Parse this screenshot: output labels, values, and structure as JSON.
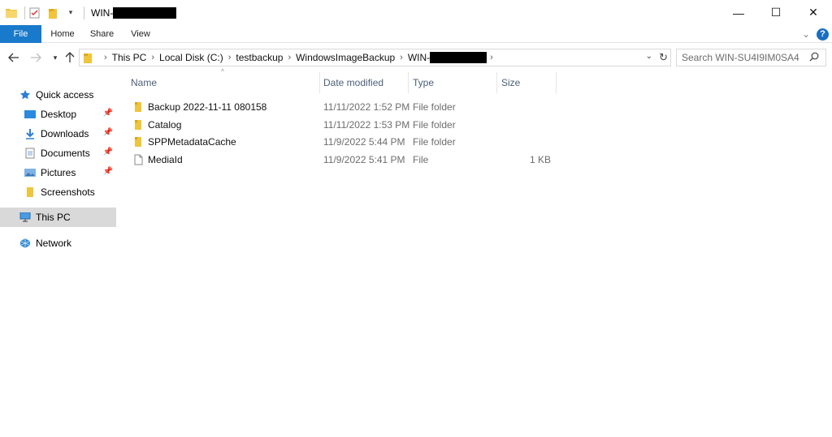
{
  "window": {
    "title_prefix": "WIN-",
    "minimize": "—",
    "maximize": "☐",
    "close": "✕"
  },
  "ribbon": {
    "tabs": [
      "File",
      "Home",
      "Share",
      "View"
    ],
    "expand": "⌄",
    "help": "?"
  },
  "address": {
    "crumbs": [
      "This PC",
      "Local Disk (C:)",
      "testbackup",
      "WindowsImageBackup",
      "WIN-"
    ]
  },
  "search": {
    "placeholder": "Search WIN-SU4I9IM0SA4"
  },
  "nav": {
    "items": [
      {
        "label": "Quick access",
        "icon": "star-icon"
      },
      {
        "label": "Desktop",
        "icon": "desktop-icon",
        "pinned": true
      },
      {
        "label": "Downloads",
        "icon": "download-icon",
        "pinned": true
      },
      {
        "label": "Documents",
        "icon": "documents-icon",
        "pinned": true
      },
      {
        "label": "Pictures",
        "icon": "pictures-icon",
        "pinned": true
      },
      {
        "label": "Screenshots",
        "icon": "folder-icon"
      },
      {
        "label": "This PC",
        "icon": "computer-icon",
        "selected": true
      },
      {
        "label": "Network",
        "icon": "network-icon"
      }
    ]
  },
  "columns": {
    "name": "Name",
    "date": "Date modified",
    "type": "Type",
    "size": "Size"
  },
  "files": [
    {
      "name": "Backup 2022-11-11 080158",
      "date": "11/11/2022 1:52 PM",
      "type": "File folder",
      "size": "",
      "icon": "folder-icon"
    },
    {
      "name": "Catalog",
      "date": "11/11/2022 1:53 PM",
      "type": "File folder",
      "size": "",
      "icon": "folder-icon"
    },
    {
      "name": "SPPMetadataCache",
      "date": "11/9/2022 5:44 PM",
      "type": "File folder",
      "size": "",
      "icon": "folder-icon"
    },
    {
      "name": "MediaId",
      "date": "11/9/2022 5:41 PM",
      "type": "File",
      "size": "1 KB",
      "icon": "file-icon"
    }
  ],
  "colors": {
    "accent": "#1979ca",
    "selected": "#d9d9d9",
    "header_text": "#4c607a",
    "folder": "#f0c43c"
  }
}
